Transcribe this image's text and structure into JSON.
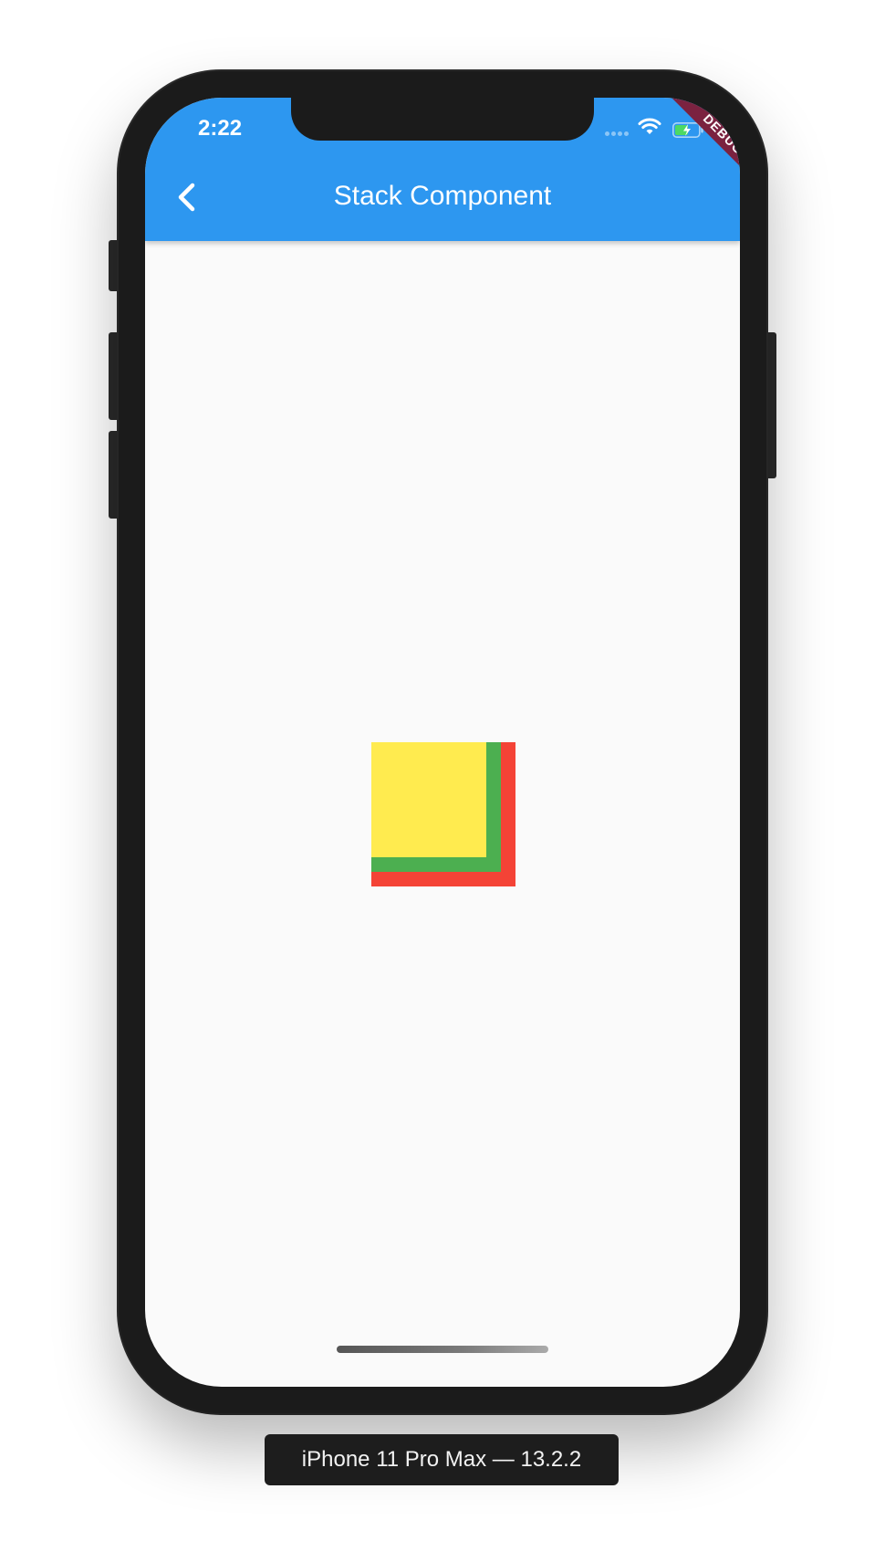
{
  "status_bar": {
    "time": "2:22",
    "icons": [
      "signal-icon",
      "wifi-icon",
      "battery-charging-icon"
    ]
  },
  "debug_banner": {
    "label": "DEBUG",
    "color": "#7b2240"
  },
  "app_bar": {
    "title": "Stack Component",
    "back_icon": "chevron-left-icon",
    "color": "#2d97f0"
  },
  "stack": {
    "layers": [
      {
        "name": "red",
        "color": "#f44336"
      },
      {
        "name": "green",
        "color": "#4caf50"
      },
      {
        "name": "yellow",
        "color": "#ffeb4f"
      }
    ]
  },
  "device": {
    "label": "iPhone 11 Pro Max — 13.2.2"
  }
}
